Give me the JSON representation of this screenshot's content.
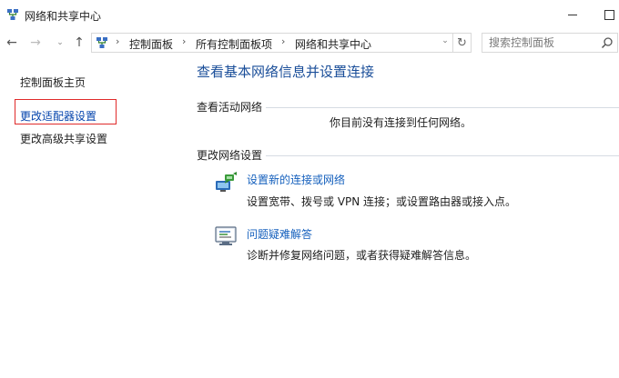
{
  "window": {
    "title": "网络和共享中心"
  },
  "navigation": {
    "back_icon": "←",
    "forward_icon": "→",
    "recent_icon": "⌄",
    "up_icon": "↑",
    "breadcrumb": [
      "控制面板",
      "所有控制面板项",
      "网络和共享中心"
    ],
    "separator": "›",
    "dropdown_icon": "⌄",
    "refresh_icon": "↻"
  },
  "search": {
    "placeholder": "搜索控制面板"
  },
  "left_pane": {
    "home": "控制面板主页",
    "adapter_settings": "更改适配器设置",
    "advanced_sharing": "更改高级共享设置"
  },
  "main": {
    "title": "查看基本网络信息并设置连接",
    "active_networks_header": "查看活动网络",
    "no_network_text": "你目前没有连接到任何网络。",
    "change_settings_header": "更改网络设置",
    "tasks": [
      {
        "icon": "network-setup-icon",
        "link": "设置新的连接或网络",
        "description": "设置宽带、拨号或 VPN 连接；或设置路由器或接入点。"
      },
      {
        "icon": "troubleshoot-icon",
        "link": "问题疑难解答",
        "description": "诊断并修复网络问题，或者获得疑难解答信息。"
      }
    ]
  },
  "colors": {
    "link_blue": "#1560bd",
    "title_blue": "#1a4e99",
    "highlight_red": "#e02a2a"
  }
}
